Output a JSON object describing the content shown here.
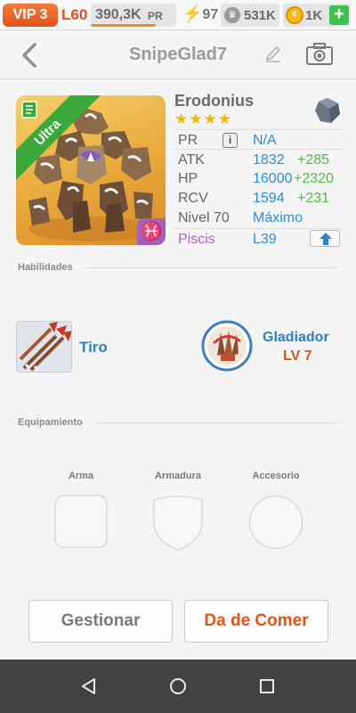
{
  "topbar": {
    "vip": "VIP 3",
    "level": "L60",
    "pr_value": "390,3K",
    "pr_unit": "PR",
    "pr_progress": 0.76,
    "energy": "97",
    "cups": "531K",
    "coins": "1K",
    "add_label": "+"
  },
  "header": {
    "title": "SnipeGlad7",
    "back_icon": "chevron-left-icon",
    "edit_icon": "pencil-icon",
    "camera_icon": "camera-icon"
  },
  "hero": {
    "name": "Erodonius",
    "rarity_label": "Ultra",
    "stars": "★★★★",
    "star_count": 4,
    "element": "rock-gem-icon",
    "zodiac_glyph": "♓",
    "stats": {
      "pr_label": "PR",
      "pr_value": "N/A",
      "atk_label": "ATK",
      "atk_value": "1832",
      "atk_bonus": "+285",
      "hp_label": "HP",
      "hp_value": "16000",
      "hp_bonus": "+2320",
      "rcv_label": "RCV",
      "rcv_value": "1594",
      "rcv_bonus": "+231",
      "level_label": "Nivel 70",
      "level_value": "Máximo",
      "sign_label": "Piscis",
      "sign_value": "L39"
    }
  },
  "skills": {
    "section_title": "Habilidades",
    "items": [
      {
        "label": "Tiro"
      },
      {
        "label": "Gladiador",
        "level": "LV 7"
      }
    ]
  },
  "equipment": {
    "section_title": "Equipamiento",
    "slots": [
      {
        "label": "Arma"
      },
      {
        "label": "Armadura"
      },
      {
        "label": "Accesorio"
      }
    ]
  },
  "actions": {
    "manage": "Gestionar",
    "feed": "Da de Comer"
  },
  "colors": {
    "accent_orange": "#e4521a",
    "stat_blue": "#2f8dd1",
    "bonus_green": "#56b84a",
    "zodiac_purple": "#b35ec1",
    "ultra_green": "#3aa93a"
  }
}
